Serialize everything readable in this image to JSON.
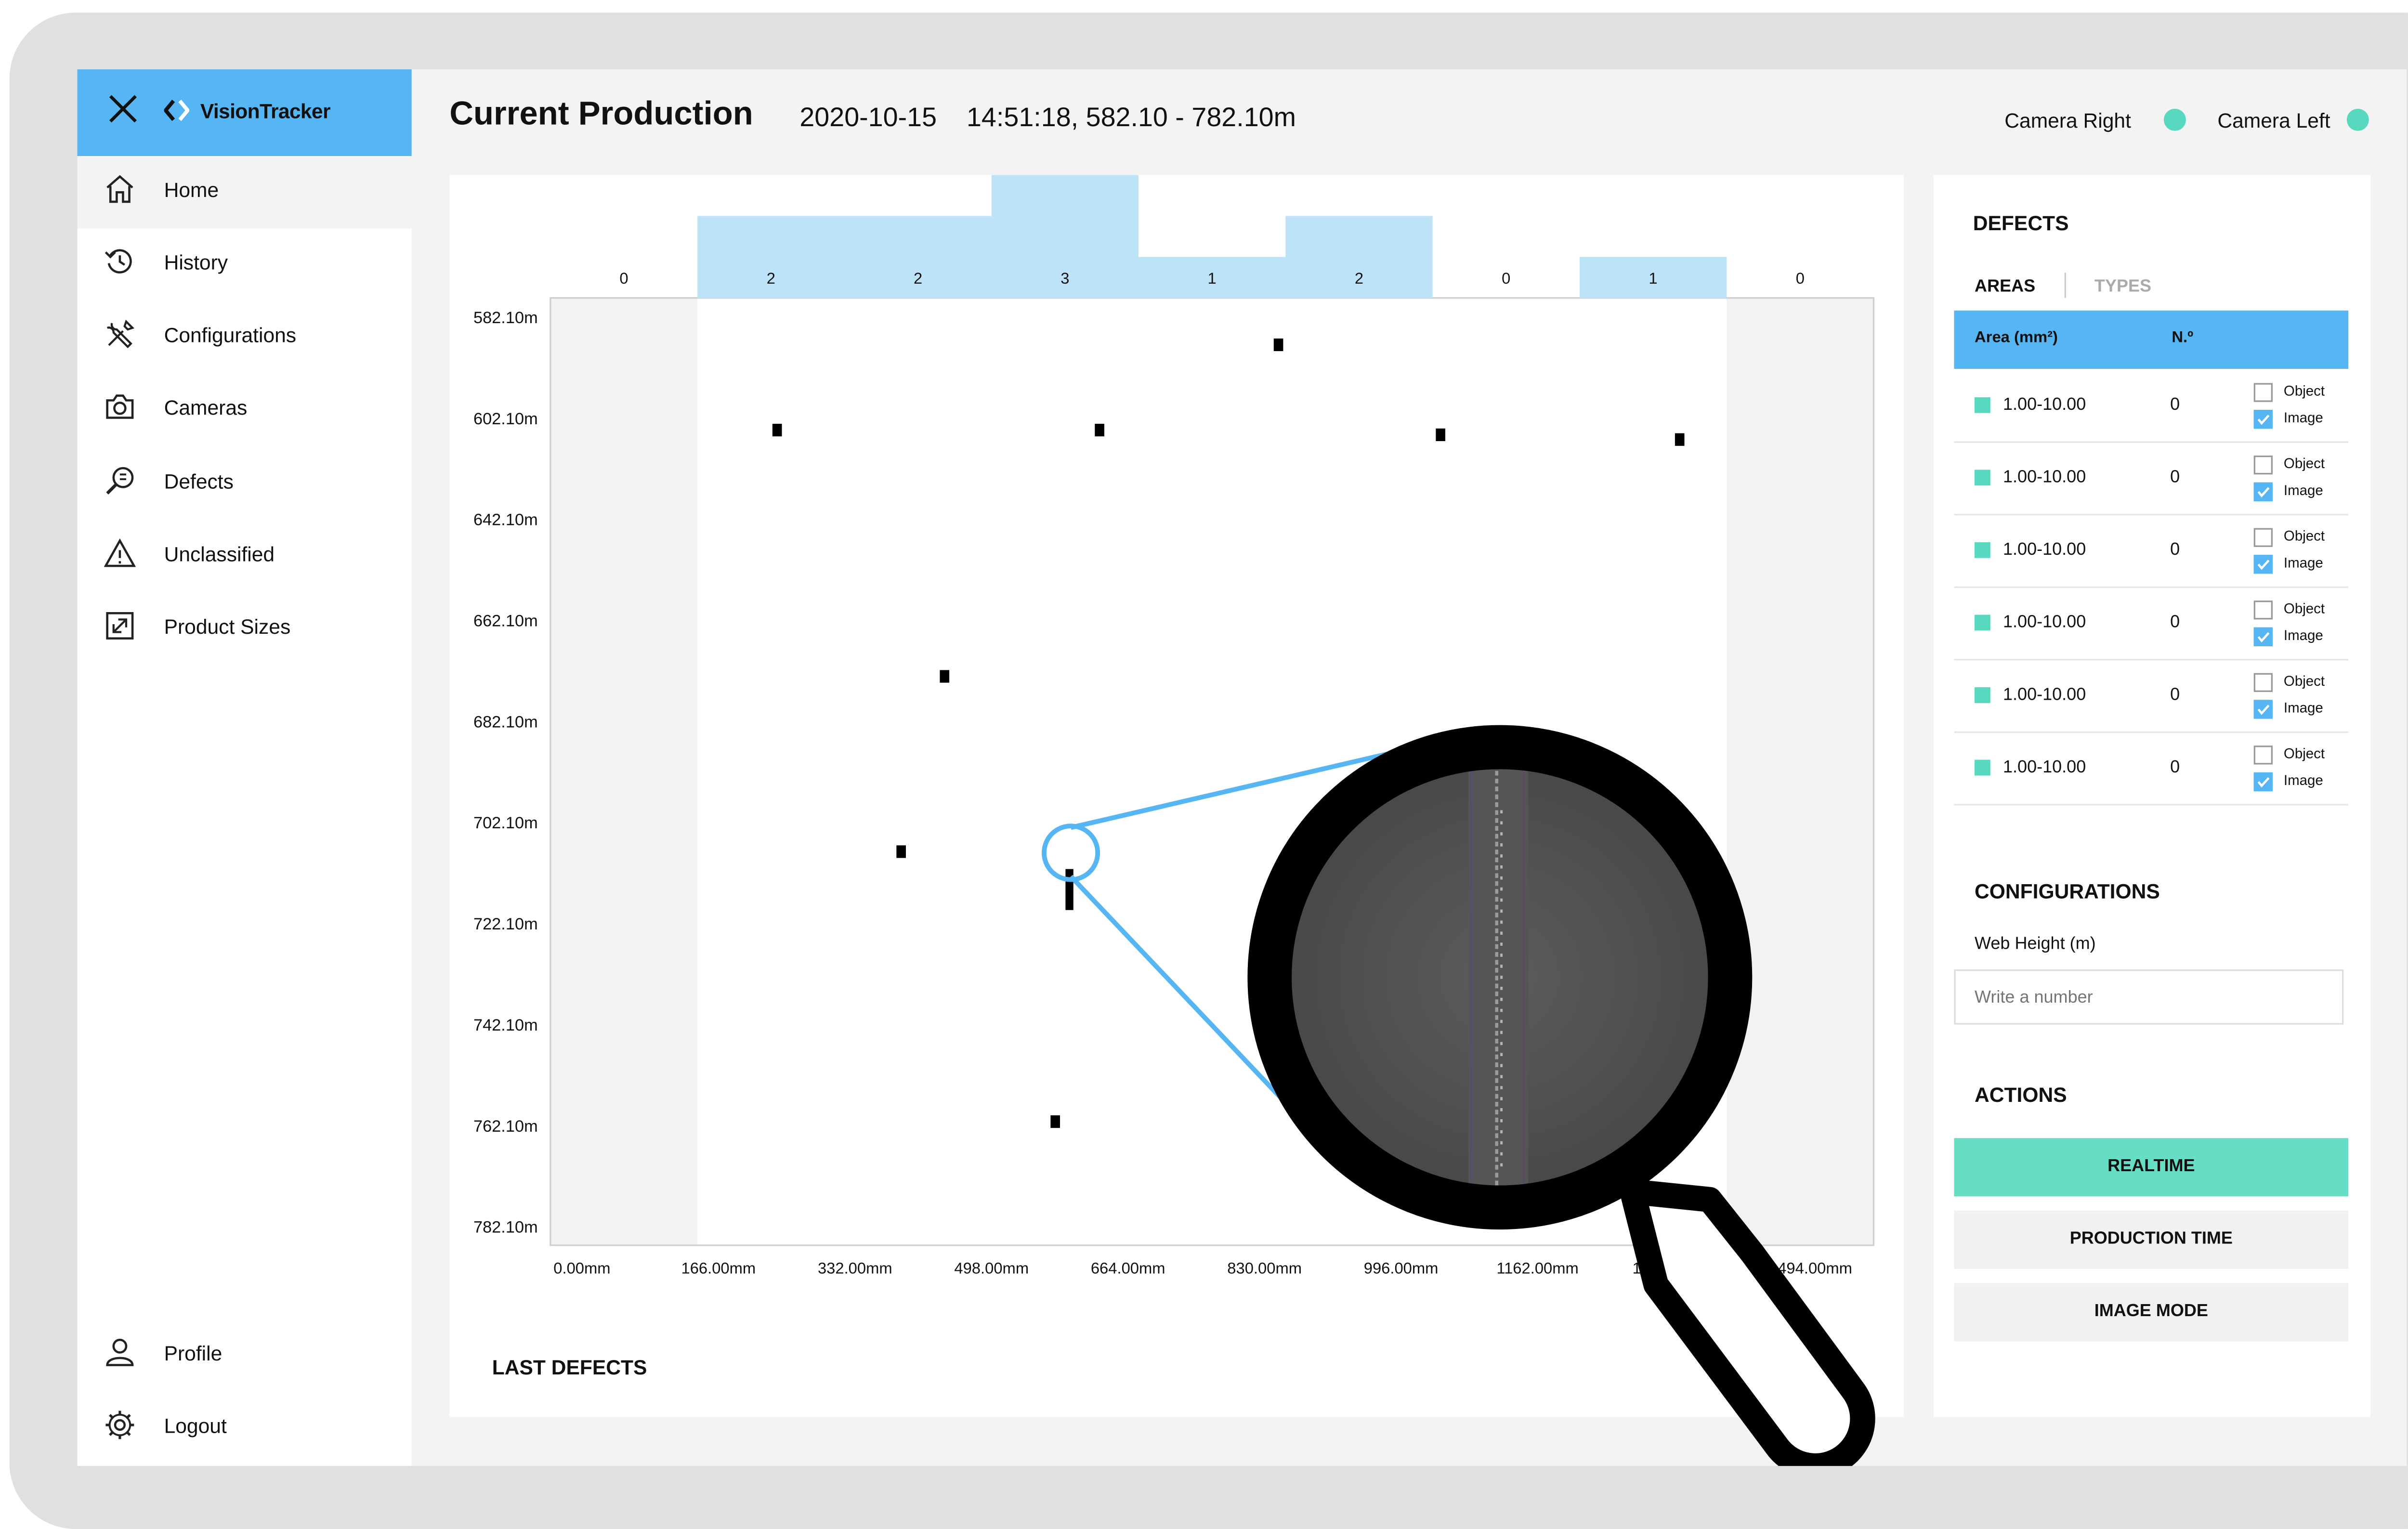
{
  "app": {
    "brand": "VisionTracker",
    "title": "Current Production",
    "subtitle": "2020-10-15    14:51:18, 582.10 - 782.10m"
  },
  "cameras": [
    {
      "label": "Camera Right",
      "status_color": "#57d8bf"
    },
    {
      "label": "Camera Left",
      "status_color": "#57d8bf"
    }
  ],
  "sidebar": {
    "items": [
      {
        "label": "Home",
        "icon": "home-icon",
        "active": true
      },
      {
        "label": "History",
        "icon": "history-icon"
      },
      {
        "label": "Configurations",
        "icon": "tools-icon"
      },
      {
        "label": "Cameras",
        "icon": "camera-icon"
      },
      {
        "label": "Defects",
        "icon": "defect-search-icon"
      },
      {
        "label": "Unclassified",
        "icon": "warning-icon"
      },
      {
        "label": "Product Sizes",
        "icon": "resize-icon"
      }
    ],
    "bottom": [
      {
        "label": "Profile",
        "icon": "user-icon"
      },
      {
        "label": "Logout",
        "icon": "gear-icon"
      }
    ]
  },
  "colors": {
    "accent": "#55b6f3",
    "teal": "#57d8bf",
    "histogram": "#bde3f8",
    "band": "#f2f2f2"
  },
  "chart_data": {
    "type": "scatter",
    "histogram_counts": [
      0,
      2,
      2,
      3,
      1,
      2,
      0,
      1,
      0
    ],
    "y_ticks": [
      "582.10m",
      "602.10m",
      "642.10m",
      "662.10m",
      "682.10m",
      "702.10m",
      "722.10m",
      "742.10m",
      "762.10m",
      "782.10m"
    ],
    "x_ticks": [
      "0.00mm",
      "166.00mm",
      "332.00mm",
      "498.00mm",
      "664.00mm",
      "830.00mm",
      "996.00mm",
      "1162.00mm",
      "1328.00mm",
      "1494.00mm"
    ],
    "xlim": [
      0,
      1494
    ],
    "ylim": [
      582.1,
      782.1
    ],
    "points": [
      {
        "x": 822,
        "y": 592
      },
      {
        "x": 256,
        "y": 610
      },
      {
        "x": 620,
        "y": 610
      },
      {
        "x": 1005,
        "y": 611
      },
      {
        "x": 1275,
        "y": 612
      },
      {
        "x": 445,
        "y": 662
      },
      {
        "x": 396,
        "y": 699
      },
      {
        "x": 586,
        "y": 707
      },
      {
        "x": 570,
        "y": 756
      }
    ],
    "highlighted_point_index": 7
  },
  "last_defects": {
    "title": "LAST DEFECTS"
  },
  "defects_panel": {
    "title": "DEFECTS",
    "tabs": [
      "AREAS",
      "TYPES"
    ],
    "active_tab": "AREAS",
    "columns": [
      "Area (mm²)",
      "N.º"
    ],
    "rows": [
      {
        "range": "1.00-10.00",
        "count": "0",
        "object": false,
        "image": true
      },
      {
        "range": "1.00-10.00",
        "count": "0",
        "object": false,
        "image": true
      },
      {
        "range": "1.00-10.00",
        "count": "0",
        "object": false,
        "image": true
      },
      {
        "range": "1.00-10.00",
        "count": "0",
        "object": false,
        "image": true
      },
      {
        "range": "1.00-10.00",
        "count": "0",
        "object": false,
        "image": true
      },
      {
        "range": "1.00-10.00",
        "count": "0",
        "object": false,
        "image": true
      }
    ],
    "checkbox_labels": {
      "object": "Object",
      "image": "Image"
    }
  },
  "configurations": {
    "title": "CONFIGURATIONS",
    "web_height_label": "Web Height (m)",
    "web_height_placeholder": "Write a number",
    "web_height_value": ""
  },
  "actions": {
    "title": "ACTIONS",
    "buttons": [
      {
        "label": "REALTIME",
        "primary": true
      },
      {
        "label": "PRODUCTION TIME",
        "primary": false
      },
      {
        "label": "IMAGE MODE",
        "primary": false
      }
    ]
  }
}
